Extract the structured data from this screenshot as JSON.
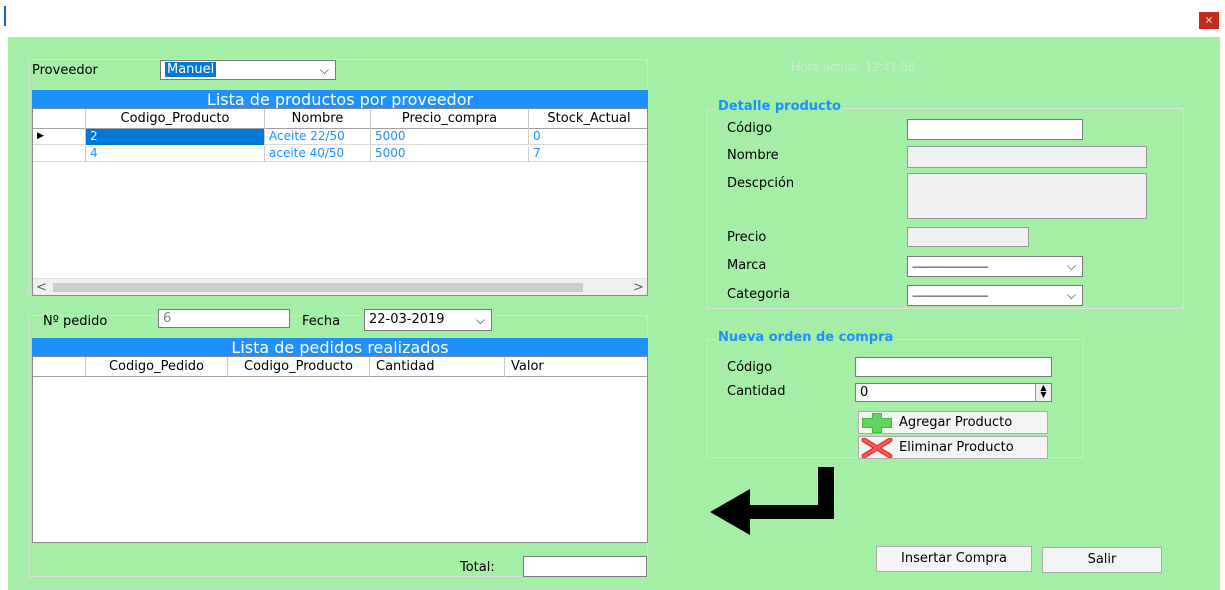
{
  "window": {
    "close_label": "×"
  },
  "header": {
    "proveedor_label": "Proveedor",
    "proveedor_value": "Manuel",
    "hora_actual": "Hora actual: 12:41:58"
  },
  "productos": {
    "caption": "Lista de productos por proveedor",
    "columns": [
      "Codigo_Producto",
      "Nombre",
      "Precio_compra",
      "Stock_Actual"
    ],
    "rows": [
      {
        "codigo": "2",
        "nombre": "Aceite 22/50",
        "precio": "5000",
        "stock": "0"
      },
      {
        "codigo": "4",
        "nombre": "aceite 40/50",
        "precio": "5000",
        "stock": "7"
      }
    ],
    "current_row_marker": "▶",
    "scroll_left": "<",
    "scroll_right": ">"
  },
  "pedido": {
    "numero_label": "Nº pedido",
    "numero_value": "6",
    "fecha_label": "Fecha",
    "fecha_value": "22-03-2019"
  },
  "pedidos": {
    "caption": "Lista de pedidos realizados",
    "columns": [
      "Codigo_Pedido",
      "Codigo_Producto",
      "Cantidad",
      "Valor"
    ]
  },
  "total": {
    "label": "Total:",
    "value": ""
  },
  "detalle": {
    "title": "Detalle producto",
    "codigo_label": "Código",
    "codigo_value": "",
    "nombre_label": "Nombre",
    "nombre_value": "",
    "descripcion_label": "Descpción",
    "descripcion_value": "",
    "precio_label": "Precio",
    "precio_value": "",
    "marca_label": "Marca",
    "marca_value": "-----------------------------",
    "categoria_label": "Categoria",
    "categoria_value": "-----------------------------"
  },
  "orden": {
    "title": "Nueva orden de compra",
    "codigo_label": "Código",
    "codigo_value": "",
    "cantidad_label": "Cantidad",
    "cantidad_value": "0",
    "agregar_label": "Agregar Producto",
    "eliminar_label": "Eliminar Producto"
  },
  "actions": {
    "insertar_label": "Insertar Compra",
    "salir_label": "Salir"
  },
  "icons": {
    "add": "plus-icon",
    "remove": "x-icon",
    "return": "return-arrow-icon"
  }
}
